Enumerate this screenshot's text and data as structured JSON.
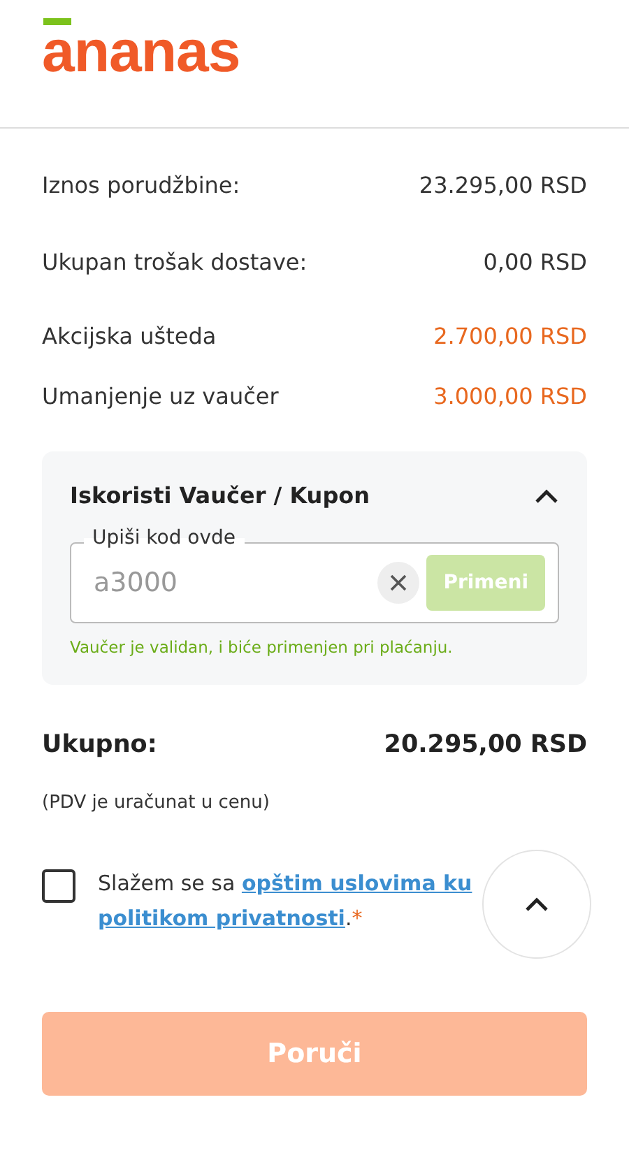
{
  "header": {
    "logo": "ananas"
  },
  "summary": [
    {
      "label": "Iznos porudžbine:",
      "value": "23.295,00 RSD",
      "kind": "plain"
    },
    {
      "label": "Ukupan trošak dostave:",
      "value": "0,00 RSD",
      "kind": "plain"
    },
    {
      "label": "Akcijska ušteda",
      "value": "2.700,00 RSD",
      "kind": "discount"
    },
    {
      "label": "Umanjenje uz vaučer",
      "value": "3.000,00 RSD",
      "kind": "discount"
    }
  ],
  "voucher": {
    "title": "Iskoristi Vaučer / Kupon",
    "expanded": true,
    "field_label": "Upiši kod ovde",
    "value": "a3000",
    "apply_button": "Primeni",
    "apply_disabled": true,
    "message": "Vaučer je validan, i biće primenjen pri plaćanju."
  },
  "total": {
    "label": "Ukupno:",
    "value": "20.295,00 RSD",
    "note": "(PDV je uračunat u cenu)"
  },
  "terms": {
    "checked": false,
    "prefix": "Slažem se sa ",
    "link_1": "opštim uslovima ku",
    "link_2": "politikom privatnosti",
    "suffix": ".",
    "required_mark": "*"
  },
  "order_button": {
    "label": "Poruči",
    "disabled": true
  }
}
